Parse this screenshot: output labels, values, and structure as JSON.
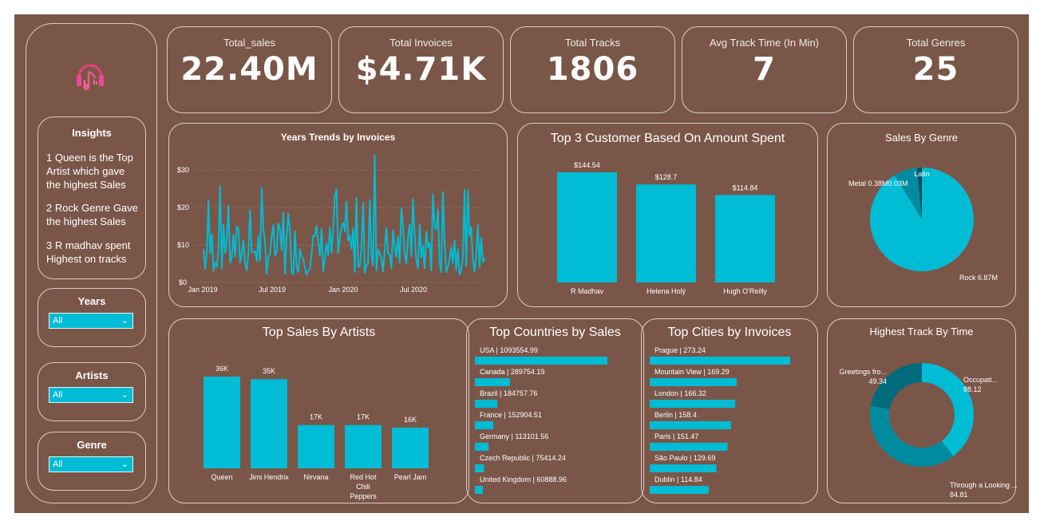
{
  "colors": {
    "background": "#7a5648",
    "accent": "#00bcd4",
    "border": "#d9cdc6",
    "dark_teal": "#006b7d",
    "mid_teal": "#008ba0"
  },
  "logo": {
    "icon": "headphones-music-icon"
  },
  "insights": {
    "title": "Insights",
    "lines": [
      "1 Queen is the Top Artist which gave the highest Sales",
      "2 Rock Genre Gave the highest Sales",
      "3 R madhav spent Highest on tracks"
    ]
  },
  "slicers": [
    {
      "title": "Years",
      "value": "All"
    },
    {
      "title": "Artists",
      "value": "All"
    },
    {
      "title": "Genre",
      "value": "All"
    }
  ],
  "kpis": [
    {
      "title": "Total_sales",
      "value": "22.40M"
    },
    {
      "title": "Total Invoices",
      "value": "$4.71K"
    },
    {
      "title": "Total Tracks",
      "value": "1806"
    },
    {
      "title": "Avg Track Time (In Min)",
      "value": "7"
    },
    {
      "title": "Total Genres",
      "value": "25"
    }
  ],
  "trend": {
    "title": "Years Trends by Invoices",
    "y_ticks": [
      "$0",
      "$10",
      "$20",
      "$30"
    ],
    "x_ticks": [
      "Jan 2019",
      "Jul 2019",
      "Jan 2020",
      "Jul 2020"
    ]
  },
  "top_customers": {
    "title": "Top 3 Customer Based On Amount Spent",
    "items": [
      {
        "name": "R Madhav",
        "value": 144.54,
        "label": "$144.54"
      },
      {
        "name": "Helena Holý",
        "value": 128.7,
        "label": "$128.7"
      },
      {
        "name": "Hugh O'Reilly",
        "value": 114.84,
        "label": "$114.84"
      }
    ]
  },
  "genre_pie": {
    "title": "Sales By Genre",
    "labels": {
      "latin": "Latin",
      "metal": "Metal 0.38M0.03M",
      "rock": "Rock 6.87M"
    }
  },
  "artists": {
    "title": "Top Sales By Artists",
    "items": [
      {
        "name": [
          "Queen"
        ],
        "value": 36,
        "label": "36K"
      },
      {
        "name": [
          "Jimi Hendrix"
        ],
        "value": 35,
        "label": "35K"
      },
      {
        "name": [
          "Nirvana"
        ],
        "value": 17,
        "label": "17K"
      },
      {
        "name": [
          "Red Hot",
          "Chili",
          "Peppers"
        ],
        "value": 17,
        "label": "17K"
      },
      {
        "name": [
          "Pearl Jam"
        ],
        "value": 16,
        "label": "16K"
      }
    ]
  },
  "countries": {
    "title": "Top Countries by Sales",
    "items": [
      {
        "label": "USA | 1093554.99",
        "value": 1093554.99
      },
      {
        "label": "Canada | 289754.19",
        "value": 289754.19
      },
      {
        "label": "Brazil | 184757.76",
        "value": 184757.76
      },
      {
        "label": "France | 152904.51",
        "value": 152904.51
      },
      {
        "label": "Germany | 113101.56",
        "value": 113101.56
      },
      {
        "label": "Czech Republic | 75414.24",
        "value": 75414.24
      },
      {
        "label": "United Kingdom | 60888.96",
        "value": 60888.96
      }
    ]
  },
  "cities": {
    "title": "Top Cities by Invoices",
    "items": [
      {
        "label": "Prague | 273.24",
        "value": 273.24
      },
      {
        "label": "Mountain View | 169.29",
        "value": 169.29
      },
      {
        "label": "London | 166.32",
        "value": 166.32
      },
      {
        "label": "Berlin | 158.4",
        "value": 158.4
      },
      {
        "label": "Paris | 151.47",
        "value": 151.47
      },
      {
        "label": "São Paulo | 129.69",
        "value": 129.69
      },
      {
        "label": "Dublin | 114.84",
        "value": 114.84
      }
    ]
  },
  "track_donut": {
    "title": "Highest Track By Time",
    "items": [
      {
        "name": "Occupati...",
        "value": 88.12,
        "value_label": "88.12"
      },
      {
        "name": "Through a Looking ...",
        "value": 84.81,
        "value_label": "84.81"
      },
      {
        "name": "Greetings fro...",
        "value": 49.34,
        "value_label": "49.34"
      }
    ]
  }
}
